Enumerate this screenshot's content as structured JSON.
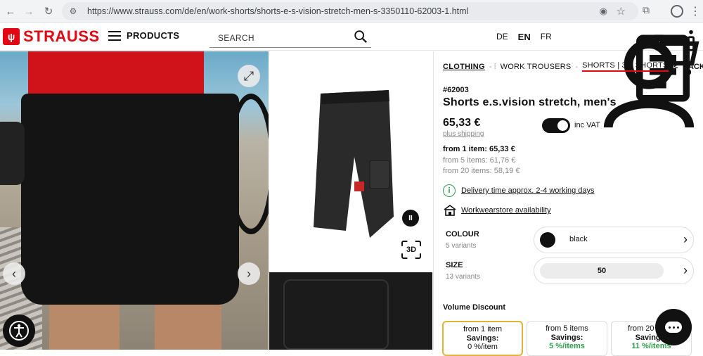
{
  "browser": {
    "url": "https://www.strauss.com/de/en/work-shorts/shorts-e-s-vision-stretch-men-s-3350110-62003-1.html"
  },
  "header": {
    "logo_text": "STRAUSS",
    "products_label": "PRODUCTS",
    "search_placeholder": "SEARCH",
    "languages": [
      "DE",
      "EN",
      "FR"
    ]
  },
  "breadcrumb": {
    "items": [
      "CLOTHING",
      "WORK TROUSERS",
      "SHORTS | 3/4 SHORTS"
    ],
    "back_label": "BACK"
  },
  "gallery": {
    "btn_3d_label": "3D"
  },
  "product": {
    "article_no": "#62003",
    "title": "Shorts e.s.vision stretch, men's",
    "price": "65,33 €",
    "shipping_label": "plus shipping",
    "vat_label": "inc VAT",
    "vat_toggle_on": true,
    "tier_prices": [
      "from 1 item: 65,33 €",
      "from 5 items: 61,76 €",
      "from 20 items: 58,19 €"
    ],
    "delivery_text": "Delivery time approx. 2-4 working days",
    "store_text": "Workwearstore availability"
  },
  "options": {
    "colour": {
      "label": "COLOUR",
      "sub": "5 variants",
      "value": "black",
      "swatch": "#111111"
    },
    "size": {
      "label": "SIZE",
      "sub": "13 variants",
      "value": "50"
    }
  },
  "volume_discount": {
    "title": "Volume Discount",
    "cards": [
      {
        "qty": "from 1 item",
        "savings_label": "Savings:",
        "pct": "0 %/item"
      },
      {
        "qty": "from 5 items",
        "savings_label": "Savings:",
        "pct": "5 %/items"
      },
      {
        "qty": "from 20 items",
        "savings_label": "Savings:",
        "pct": "11 %/items"
      }
    ]
  },
  "colors": {
    "brand": "#e30613",
    "accent_green": "#2e9e4b",
    "selected_border": "#e0b43a"
  }
}
